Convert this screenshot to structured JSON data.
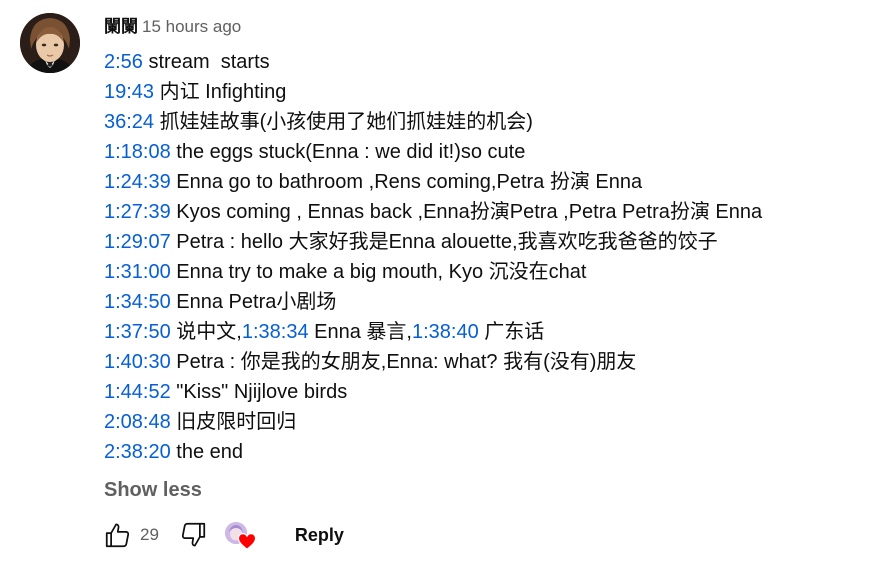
{
  "comment": {
    "author": "闌闌",
    "time": "15 hours ago",
    "lines": [
      {
        "segments": [
          {
            "ts": "2:56"
          },
          {
            "text": " stream  starts"
          }
        ]
      },
      {
        "segments": [
          {
            "ts": "19:43"
          },
          {
            "text": " 内讧 Infighting"
          }
        ]
      },
      {
        "segments": [
          {
            "ts": "36:24"
          },
          {
            "text": " 抓娃娃故事(小孩使用了她们抓娃娃的机会)"
          }
        ]
      },
      {
        "segments": [
          {
            "ts": "1:18:08"
          },
          {
            "text": " the eggs stuck(Enna : we did it!)so cute"
          }
        ]
      },
      {
        "segments": [
          {
            "ts": "1:24:39"
          },
          {
            "text": " Enna go to bathroom ,Rens coming,Petra 扮演 Enna"
          }
        ]
      },
      {
        "segments": [
          {
            "ts": "1:27:39"
          },
          {
            "text": " Kyos coming , Ennas back ,Enna扮演Petra ,Petra Petra扮演 Enna"
          }
        ]
      },
      {
        "segments": [
          {
            "ts": "1:29:07"
          },
          {
            "text": " Petra : hello 大家好我是Enna alouette,我喜欢吃我爸爸的饺子"
          }
        ]
      },
      {
        "segments": [
          {
            "ts": "1:31:00"
          },
          {
            "text": " Enna try to make a big mouth, Kyo 沉没在chat"
          }
        ]
      },
      {
        "segments": [
          {
            "ts": "1:34:50"
          },
          {
            "text": " Enna Petra小剧场"
          }
        ]
      },
      {
        "segments": [
          {
            "ts": "1:37:50"
          },
          {
            "text": " 说中文,"
          },
          {
            "ts": "1:38:34"
          },
          {
            "text": " Enna 暴言,"
          },
          {
            "ts": "1:38:40"
          },
          {
            "text": " 广东话"
          }
        ]
      },
      {
        "segments": [
          {
            "ts": "1:40:30"
          },
          {
            "text": " Petra : 你是我的女朋友,Enna: what? 我有(没有)朋友"
          }
        ]
      },
      {
        "segments": [
          {
            "ts": "1:44:52"
          },
          {
            "text": " \"Kiss\" Njijlove birds"
          }
        ]
      },
      {
        "segments": [
          {
            "ts": "2:08:48"
          },
          {
            "text": " 旧皮限时回归"
          }
        ]
      },
      {
        "segments": [
          {
            "ts": "2:38:20"
          },
          {
            "text": " the end"
          }
        ]
      }
    ],
    "show_less": "Show less",
    "likes": "29",
    "reply": "Reply"
  },
  "icons": {
    "like": "thumb-up-icon",
    "dislike": "thumb-down-icon",
    "creator_heart": "creator-heart-icon"
  },
  "colors": {
    "timestamp": "#065fd4",
    "secondary": "#606060",
    "heart": "#ff0000"
  }
}
